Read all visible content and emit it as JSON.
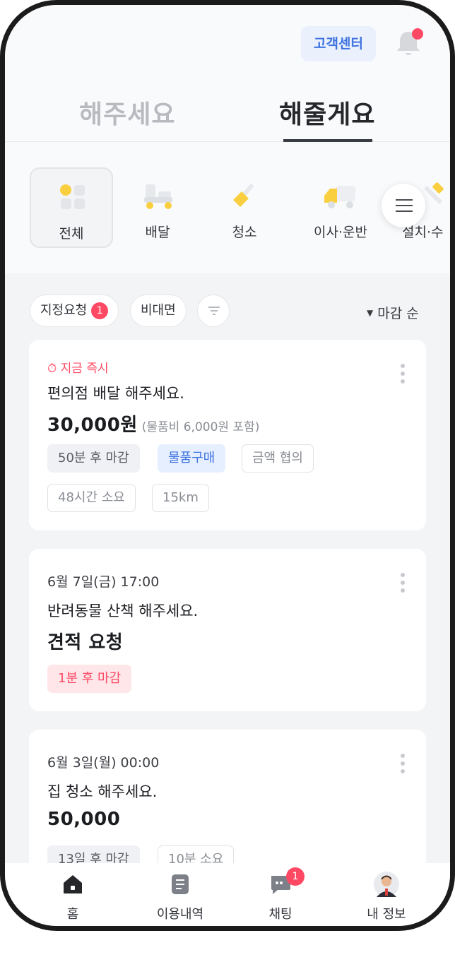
{
  "header": {
    "customer_center": "고객센터",
    "tabs": [
      {
        "label": "해주세요",
        "active": false
      },
      {
        "label": "해줄게요",
        "active": true
      }
    ]
  },
  "categories": [
    {
      "label": "전체",
      "icon": "grid-icon",
      "active": true
    },
    {
      "label": "배달",
      "icon": "scooter-icon",
      "active": false
    },
    {
      "label": "청소",
      "icon": "broom-icon",
      "active": false
    },
    {
      "label": "이사·운반",
      "icon": "truck-icon",
      "active": false
    },
    {
      "label": "설치·수",
      "icon": "tools-icon",
      "active": false
    }
  ],
  "filters": {
    "designated": "지정요청",
    "designated_count": "1",
    "contactless": "비대면",
    "sort": "마감 순"
  },
  "cards": [
    {
      "urgent": "지금 즉시",
      "title": "편의점 배달 해주세요.",
      "price": "30,000원",
      "price_note": "(물품비 6,000원 포함)",
      "tags": [
        "50분 후 마감",
        "물품구매",
        "금액 협의",
        "48시간 소요",
        "15km"
      ]
    },
    {
      "date": "6월 7일(금) 17:00",
      "title": "반려동물 산책 해주세요.",
      "price": "견적 요청",
      "tags": [
        "1분 후 마감"
      ]
    },
    {
      "date": "6월 3일(월) 00:00",
      "title": "집 청소 해주세요.",
      "price": "50,000",
      "tags": [
        "13일 후 마감",
        "10분 소요"
      ]
    }
  ],
  "bottom_nav": [
    {
      "label": "홈",
      "icon": "home-icon"
    },
    {
      "label": "이용내역",
      "icon": "document-icon"
    },
    {
      "label": "채팅",
      "icon": "chat-icon",
      "badge": "1"
    },
    {
      "label": "내 정보",
      "icon": "avatar-icon"
    }
  ],
  "colors": {
    "accent": "#ff4964",
    "blue": "#3f73e0",
    "category_yellow": "#f9cf3f"
  }
}
